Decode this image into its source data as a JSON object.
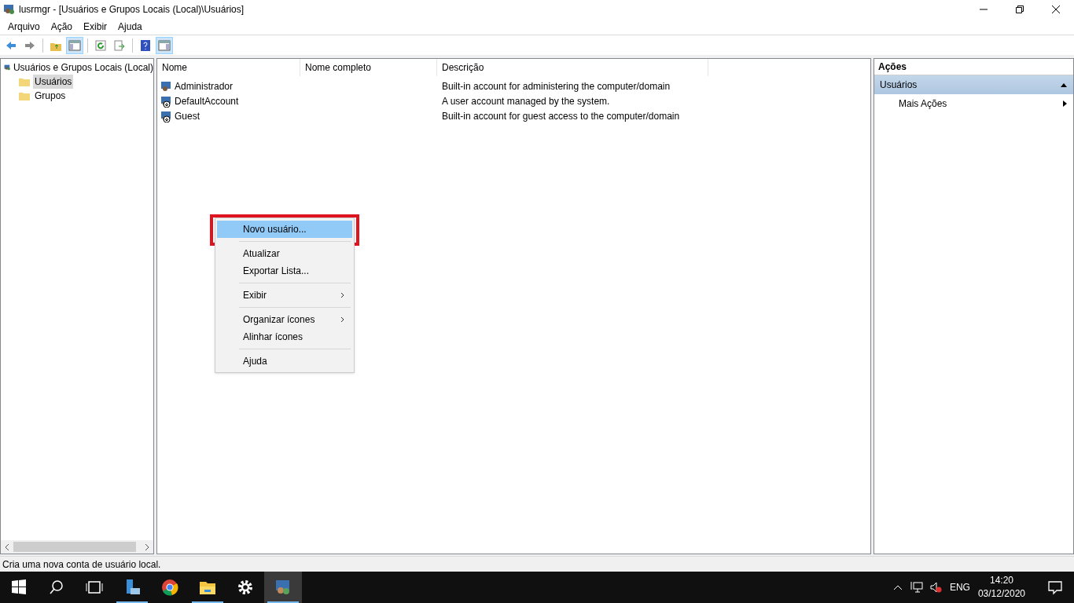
{
  "window": {
    "title": "lusrmgr - [Usuários e Grupos Locais (Local)\\Usuários]"
  },
  "menu_bar": [
    "Arquivo",
    "Ação",
    "Exibir",
    "Ajuda"
  ],
  "toolbar": [
    {
      "kind": "back",
      "selected": false
    },
    {
      "kind": "forward",
      "selected": false
    },
    {
      "kind": "sep"
    },
    {
      "kind": "up",
      "selected": false
    },
    {
      "kind": "tree",
      "selected": true
    },
    {
      "kind": "sep"
    },
    {
      "kind": "refresh",
      "selected": false
    },
    {
      "kind": "export",
      "selected": false
    },
    {
      "kind": "sep"
    },
    {
      "kind": "help",
      "selected": false
    },
    {
      "kind": "pane",
      "selected": true
    }
  ],
  "tree": {
    "label": "Usuários e Grupos Locais (Local)",
    "children": [
      {
        "label": "Usuários",
        "selected": true
      },
      {
        "label": "Grupos",
        "selected": false
      }
    ]
  },
  "table": {
    "columns": [
      "Nome",
      "Nome completo",
      "Descrição"
    ],
    "rows": [
      {
        "name": "Administrador",
        "kind": "admin",
        "full_name": "",
        "description": "Built-in account for administering the computer/domain"
      },
      {
        "name": "DefaultAccount",
        "kind": "disabled",
        "description": "A user account managed by the system."
      },
      {
        "name": "Guest",
        "kind": "disabled",
        "description": "Built-in account for guest access to the computer/domain"
      }
    ]
  },
  "context_menu": [
    {
      "kind": "item",
      "label": "Novo usuário...",
      "selected": true,
      "submenu": false
    },
    {
      "kind": "separator"
    },
    {
      "kind": "item",
      "label": "Atualizar",
      "selected": false,
      "submenu": false
    },
    {
      "kind": "item",
      "label": "Exportar Lista...",
      "selected": false,
      "submenu": false
    },
    {
      "kind": "separator"
    },
    {
      "kind": "item",
      "label": "Exibir",
      "selected": false,
      "submenu": true
    },
    {
      "kind": "separator"
    },
    {
      "kind": "item",
      "label": "Organizar ícones",
      "selected": false,
      "submenu": true
    },
    {
      "kind": "item",
      "label": "Alinhar ícones",
      "selected": false,
      "submenu": false
    },
    {
      "kind": "separator"
    },
    {
      "kind": "item",
      "label": "Ajuda",
      "selected": false,
      "submenu": false
    }
  ],
  "actions": {
    "title": "Ações",
    "section": "Usuários",
    "items": [
      "Mais Ações"
    ]
  },
  "status_bar": "Cria uma nova conta de usuário local.",
  "taskbar": {
    "apps": [
      {
        "kind": "server",
        "open": true,
        "selected": false
      },
      {
        "kind": "chrome",
        "open": false,
        "selected": false
      },
      {
        "kind": "folder",
        "open": true,
        "selected": false
      },
      {
        "kind": "gear",
        "open": false,
        "selected": false
      },
      {
        "kind": "users",
        "open": true,
        "selected": true
      }
    ],
    "language": "ENG",
    "time": "14:20",
    "date": "03/12/2020"
  }
}
